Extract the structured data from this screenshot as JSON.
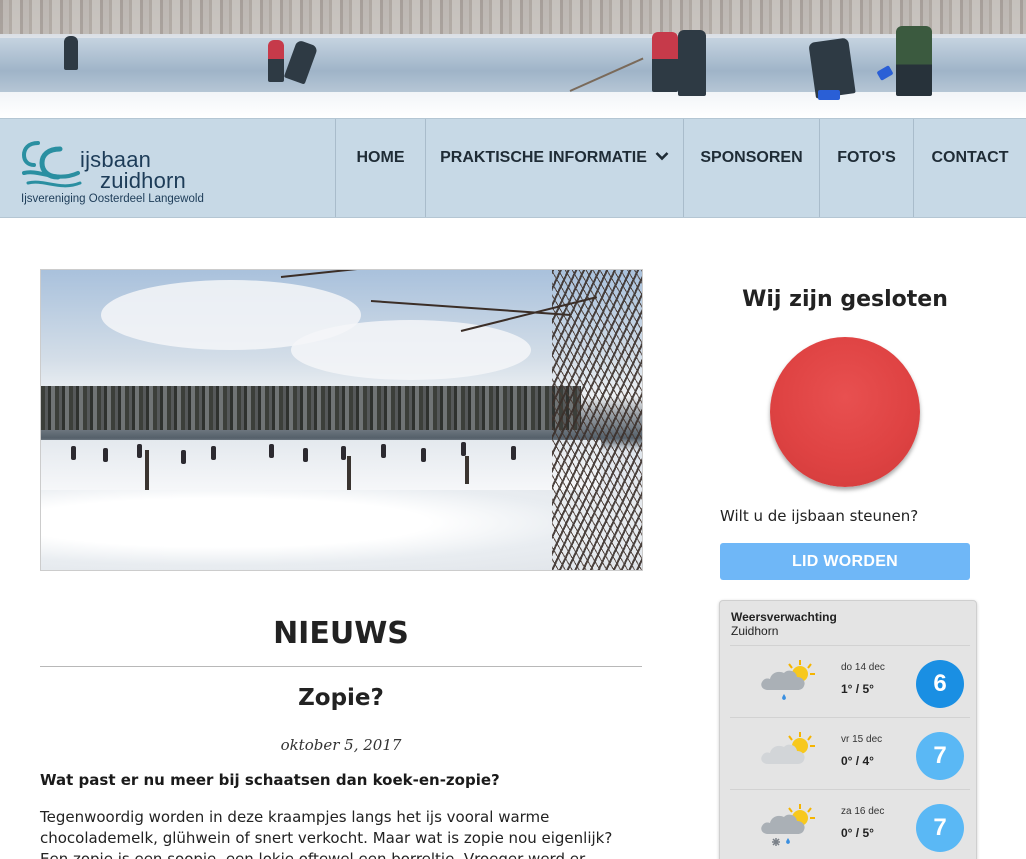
{
  "logo": {
    "name_line1": "ijsbaan",
    "name_line2": "zuidhorn",
    "subtitle": "Ijsvereniging Oosterdeel Langewold"
  },
  "nav": {
    "items": [
      {
        "label": "HOME"
      },
      {
        "label": "PRAKTISCHE INFORMATIE",
        "has_dropdown": true
      },
      {
        "label": "SPONSOREN"
      },
      {
        "label": "FOTO'S"
      },
      {
        "label": "CONTACT"
      }
    ]
  },
  "main": {
    "section_title": "NIEUWS",
    "post": {
      "title": "Zopie?",
      "date": "oktober 5, 2017",
      "lead": "Wat past er nu meer bij schaatsen dan koek-en-zopie?",
      "body": "Tegenwoordig worden in deze kraampjes langs het ijs vooral warme chocolademelk, glühwein of snert verkocht. Maar wat is zopie nou eigenlijk? Een zopie is een soopje, een lokje oftewel een borreltje. Vroeger werd er veel"
    }
  },
  "sidebar": {
    "status_title": "Wij zijn gesloten",
    "status_color": "#df4343",
    "support_text": "Wilt u de ijsbaan steunen?",
    "join_label": "LID WORDEN",
    "weather": {
      "title": "Weersverwachting",
      "place": "Zuidhorn",
      "days": [
        {
          "day": "do 14 dec",
          "temp": "1° / 5°",
          "score": "6",
          "icon": "cloud-sun-rain-icon",
          "badge_color": "#1a8fe3"
        },
        {
          "day": "vr 15 dec",
          "temp": "0° / 4°",
          "score": "7",
          "icon": "cloud-sun-icon",
          "badge_color": "#5ab8f5"
        },
        {
          "day": "za 16 dec",
          "temp": "0° / 5°",
          "score": "7",
          "icon": "cloud-sun-snow-rain-icon",
          "badge_color": "#5ab8f5"
        }
      ]
    }
  }
}
